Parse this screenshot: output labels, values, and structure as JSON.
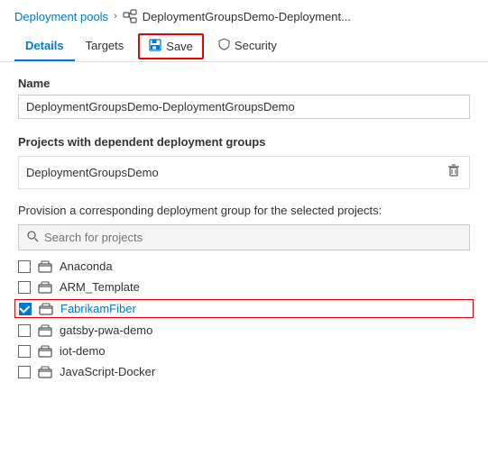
{
  "breadcrumb": {
    "link_label": "Deployment pools",
    "separator": "›",
    "icon_label": "deployment-groups-icon",
    "current": "DeploymentGroupsDemo-Deployment..."
  },
  "tabs": [
    {
      "id": "details",
      "label": "Details",
      "active": true
    },
    {
      "id": "targets",
      "label": "Targets",
      "active": false
    },
    {
      "id": "save",
      "label": "Save",
      "active": false,
      "is_save": true
    },
    {
      "id": "security",
      "label": "Security",
      "active": false
    }
  ],
  "form": {
    "name_label": "Name",
    "name_value": "DeploymentGroupsDemo-DeploymentGroupsDemo"
  },
  "dependent_section": {
    "title": "Projects with dependent deployment groups",
    "project_name": "DeploymentGroupsDemo",
    "trash_label": "delete"
  },
  "provision_section": {
    "label": "Provision a corresponding deployment group for the selected projects:",
    "search_placeholder": "Search for projects",
    "projects": [
      {
        "id": "anaconda",
        "name": "Anaconda",
        "checked": false,
        "highlighted": false
      },
      {
        "id": "arm-template",
        "name": "ARM_Template",
        "checked": false,
        "highlighted": false
      },
      {
        "id": "fabrikamfiber",
        "name": "FabrikamFiber",
        "checked": true,
        "highlighted": true
      },
      {
        "id": "gatsby-pwa-demo",
        "name": "gatsby-pwa-demo",
        "checked": false,
        "highlighted": false
      },
      {
        "id": "iot-demo",
        "name": "iot-demo",
        "checked": false,
        "highlighted": false
      },
      {
        "id": "javascript-docker",
        "name": "JavaScript-Docker",
        "checked": false,
        "highlighted": false
      }
    ]
  }
}
